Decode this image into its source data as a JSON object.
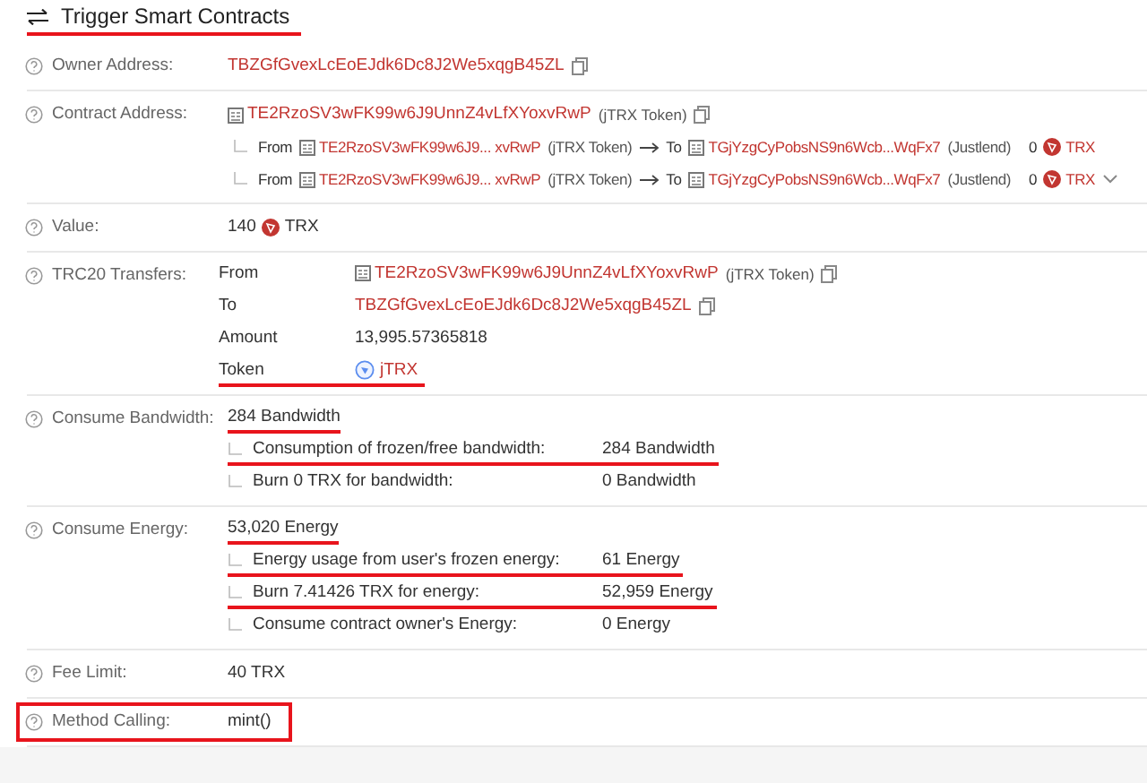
{
  "title": {
    "text": "Trigger Smart Contracts",
    "underlined": true
  },
  "rows": [
    {
      "kind": "address",
      "label": "Owner Address:",
      "boxed": false,
      "address": "TBZGfGvexLcEoEJdk6Dc8J2We5xqgB45ZL"
    },
    {
      "kind": "contract",
      "label": "Contract Address:",
      "boxed": false,
      "address": "TE2RzoSV3wFK99w6J9UnnZ4vLfXYoxvRwP",
      "tag": "(jTRX Token)",
      "internal": [
        {
          "from_label": "From",
          "from": "TE2RzoSV3wFK99w6J9... xvRwP",
          "from_tag": "(jTRX Token)",
          "to_label": "To",
          "to": "TGjYzgCyPobsNS9n6Wcb...WqFx7",
          "to_tag": "(Justlend)",
          "amount": "0",
          "unit": "TRX"
        },
        {
          "from_label": "From",
          "from": "TE2RzoSV3wFK99w6J9... xvRwP",
          "from_tag": "(jTRX Token)",
          "to_label": "To",
          "to": "TGjYzgCyPobsNS9n6Wcb...WqFx7",
          "to_tag": "(Justlend)",
          "amount": "0",
          "unit": "TRX"
        }
      ]
    },
    {
      "kind": "value",
      "label": "Value:",
      "boxed": false,
      "amount": "140",
      "unit": "TRX"
    },
    {
      "kind": "transfers",
      "label": "TRC20 Transfers:",
      "boxed": false,
      "lines": [
        {
          "kind": "contract",
          "label": "From",
          "value": "TE2RzoSV3wFK99w6J9UnnZ4vLfXYoxvRwP",
          "tag": "(jTRX Token)",
          "underlined": false
        },
        {
          "kind": "address",
          "label": "To",
          "value": "TBZGfGvexLcEoEJdk6Dc8J2We5xqgB45ZL",
          "underlined": false
        },
        {
          "kind": "text",
          "label": "Amount",
          "value": "13,995.57365818",
          "underlined": false
        },
        {
          "kind": "token",
          "label": "Token",
          "value": "jTRX",
          "underlined": true
        }
      ]
    },
    {
      "kind": "resource",
      "label": "Consume Bandwidth:",
      "boxed": false,
      "value": "284 Bandwidth",
      "underlined": true,
      "sub": [
        {
          "label": "Consumption of frozen/free bandwidth:",
          "value": "284 Bandwidth",
          "underlined": true
        },
        {
          "label": "Burn 0 TRX for bandwidth:",
          "value": "0 Bandwidth",
          "underlined": false
        }
      ]
    },
    {
      "kind": "resource",
      "label": "Consume Energy:",
      "boxed": false,
      "value": "53,020 Energy",
      "underlined": true,
      "sub": [
        {
          "label": "Energy usage from user's frozen energy:",
          "value": "61 Energy",
          "underlined": true
        },
        {
          "label": "Burn 7.41426 TRX for energy:",
          "value": "52,959 Energy",
          "underlined": true
        },
        {
          "label": "Consume contract owner's Energy:",
          "value": "0 Energy",
          "underlined": false
        }
      ]
    },
    {
      "kind": "plain",
      "label": "Fee Limit:",
      "boxed": false,
      "value": "40 TRX"
    },
    {
      "kind": "plain",
      "label": "Method Calling:",
      "boxed": true,
      "value": "mint()"
    }
  ]
}
